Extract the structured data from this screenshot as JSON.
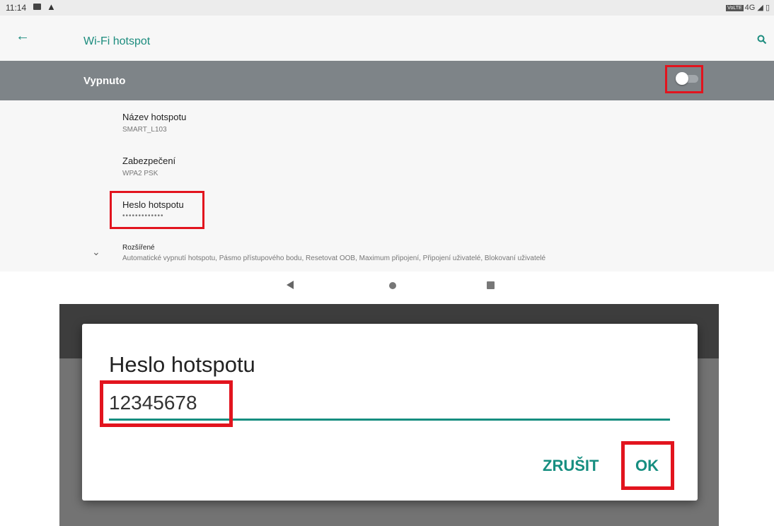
{
  "status_bar": {
    "time": "11:14",
    "volte": "VoLTE",
    "network": "4G"
  },
  "app_bar": {
    "title": "Wi-Fi hotspot"
  },
  "master_switch": {
    "label": "Vypnuto",
    "checked": false
  },
  "settings": {
    "name_title": "Název hotspotu",
    "name_value": "SMART_L103",
    "security_title": "Zabezpečení",
    "security_value": "WPA2 PSK",
    "password_title": "Heslo hotspotu",
    "password_masked": "•••••••••••••",
    "advanced_title": "Rozšířené",
    "advanced_summary": "Automatické vypnutí hotspotu, Pásmo přístupového bodu, Resetovat OOB, Maximum připojení, Připojení uživatelé, Blokovaní uživatelé"
  },
  "dialog": {
    "title": "Heslo hotspotu",
    "input_value": "12345678",
    "cancel_label": "ZRUŠIT",
    "ok_label": "OK"
  },
  "colors": {
    "accent": "#168e80",
    "highlight": "#e2141e",
    "master_bar": "#7e8488"
  },
  "icons": [
    "image-icon",
    "warning-icon",
    "back-arrow-icon",
    "search-icon",
    "chevron-down-icon",
    "nav-back-icon",
    "nav-home-icon",
    "nav-recents-icon"
  ]
}
